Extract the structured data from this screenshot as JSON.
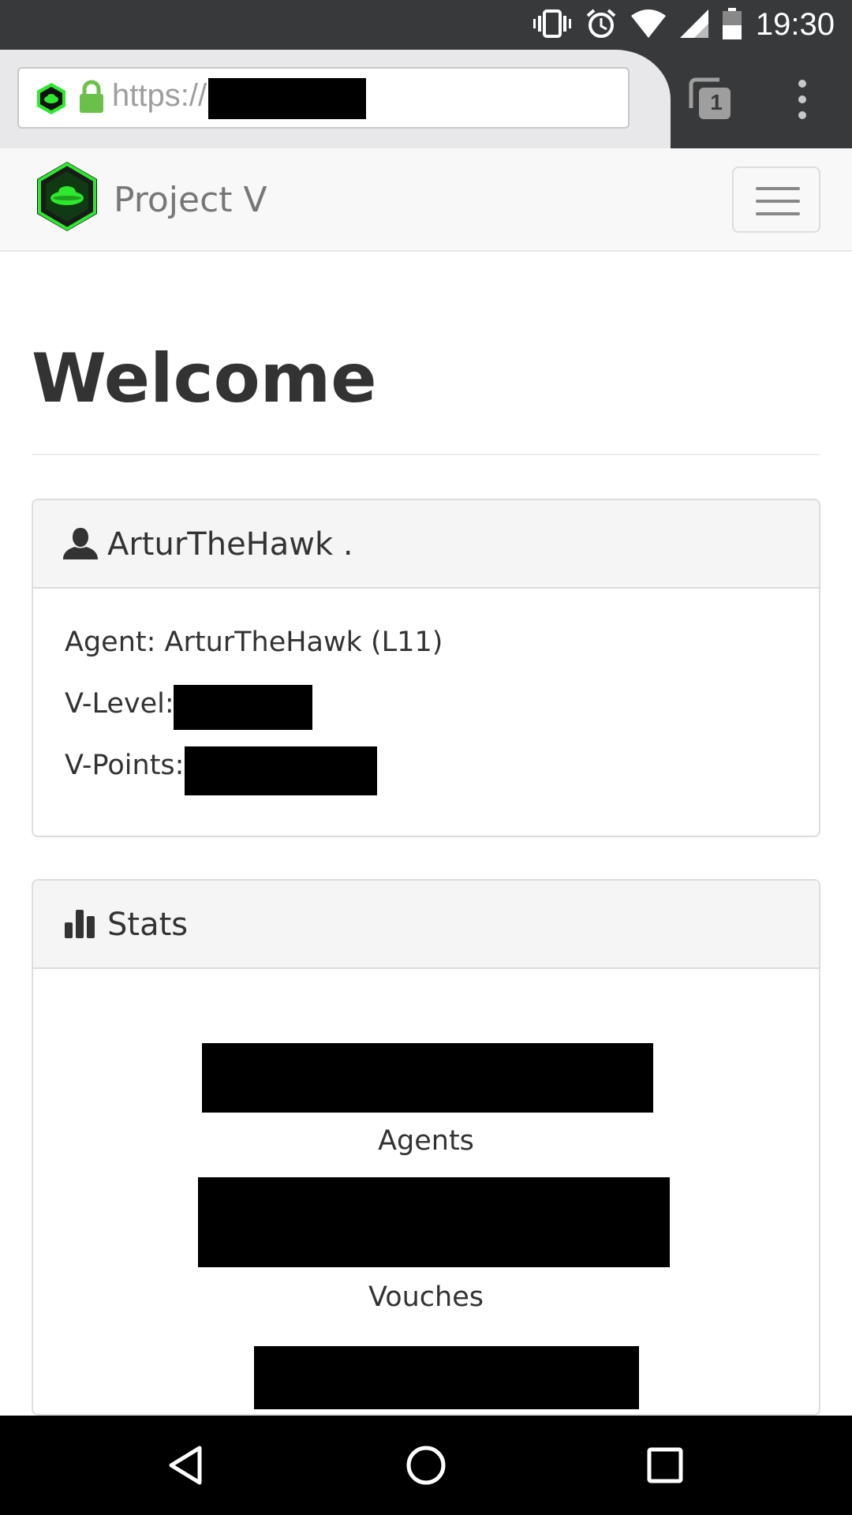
{
  "status_bar": {
    "time": "19:30",
    "icons": [
      "vibrate-icon",
      "alarm-icon",
      "wifi-icon",
      "signal-icon",
      "battery-icon"
    ]
  },
  "browser": {
    "url_prefix": "https://",
    "url_redacted": true,
    "tab_count": "1",
    "icons": [
      "site-favicon",
      "lock-icon",
      "tabs-icon",
      "overflow-menu-icon"
    ]
  },
  "navbar": {
    "brand": "Project V",
    "toggle_icon": "hamburger-icon"
  },
  "page": {
    "title": "Welcome"
  },
  "profile_panel": {
    "heading": "ArturTheHawk .",
    "icon": "user-icon",
    "agent_line": "Agent: ArturTheHawk (L11)",
    "v_level_label": "V-Level:",
    "v_points_label": "V-Points:"
  },
  "stats_panel": {
    "heading": "Stats",
    "icon": "bar-chart-icon",
    "items": [
      {
        "label": "Agents"
      },
      {
        "label": "Vouches"
      },
      {
        "label": ""
      }
    ]
  },
  "android_nav": {
    "buttons": [
      "back-icon",
      "home-icon",
      "recents-icon"
    ]
  },
  "colors": {
    "status_bar_bg": "#37393b",
    "navbar_bg": "#f8f8f8",
    "brand_green": "#2ee82e",
    "lock_green": "#6bc04b",
    "text": "#333333",
    "brand_text": "#777777"
  }
}
